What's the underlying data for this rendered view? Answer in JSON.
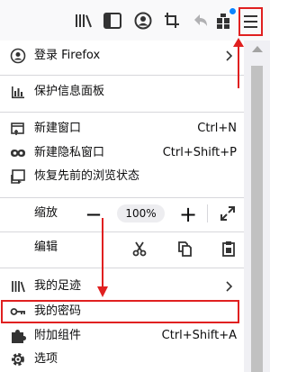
{
  "toolbar": {
    "icons": [
      "library-icon",
      "sidebar-icon",
      "account-icon",
      "screenshot-crop-icon",
      "undo-icon",
      "extensions-icon",
      "hamburger-menu-icon"
    ]
  },
  "menu": {
    "sign_in": "登录 Firefox",
    "protections": "保护信息面板",
    "new_window": {
      "label": "新建窗口",
      "shortcut": "Ctrl+N"
    },
    "new_private": {
      "label": "新建隐私窗口",
      "shortcut": "Ctrl+Shift+P"
    },
    "restore_session": "恢复先前的浏览状态",
    "zoom": {
      "label": "缩放",
      "minus": "—",
      "value": "100%",
      "plus": "+"
    },
    "edit": {
      "label": "编辑"
    },
    "library": "我的足迹",
    "passwords": "我的密码",
    "addons": {
      "label": "附加组件",
      "shortcut": "Ctrl+Shift+A"
    },
    "options": "选项"
  },
  "colors": {
    "annotation": "#e02020",
    "badge": "#0a84ff"
  }
}
